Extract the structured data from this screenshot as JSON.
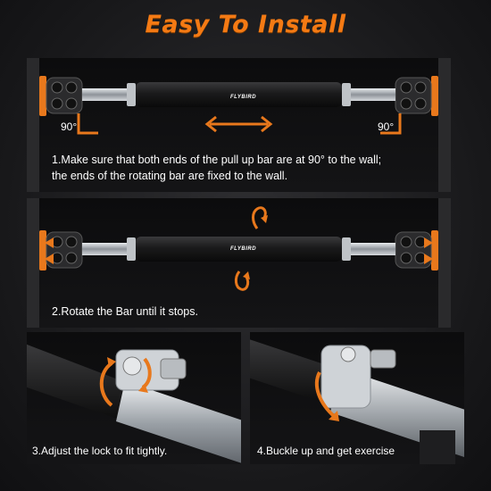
{
  "title": "Easy To Install",
  "brand": "FLYBIRD",
  "accent_color": "#f47a14",
  "steps": [
    {
      "caption_line1": "1.Make sure that both ends of the pull up bar are at 90° to the wall;",
      "caption_line2": "the ends of the rotating bar are fixed to the wall.",
      "left_angle": "90°",
      "right_angle": "90°",
      "icon": "double-arrow-horizontal-icon"
    },
    {
      "caption": "2.Rotate the Bar until it stops.",
      "icon": "rotate-arrows-icon"
    },
    {
      "caption": "3.Adjust the lock to fit tightly.",
      "icon": "curved-arrow-icon"
    },
    {
      "caption": "4.Buckle up and get exercise",
      "icon": "curved-arrow-icon"
    }
  ]
}
